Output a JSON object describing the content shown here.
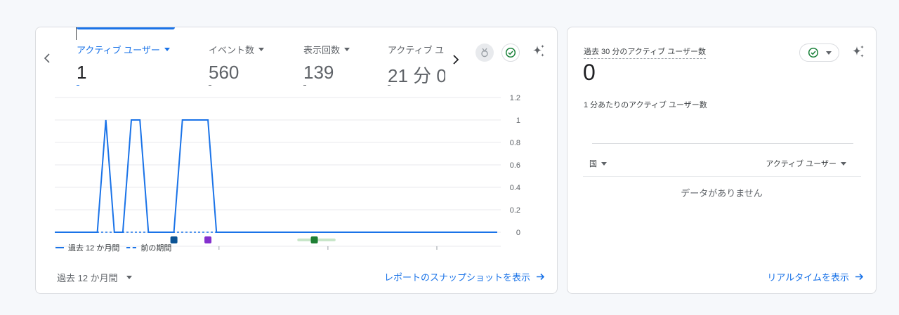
{
  "overview": {
    "metrics": [
      {
        "label": "アクティブ ユーザー",
        "value": "1",
        "active": true
      },
      {
        "label": "イベント数",
        "value": "560",
        "active": false
      },
      {
        "label": "表示回数",
        "value": "139",
        "active": false
      },
      {
        "label": "アクティブ ユ",
        "value": "21 分 0",
        "active": false
      }
    ],
    "legend": {
      "current": "過去 12 か月間",
      "previous": "前の期間"
    },
    "date_range": "過去 12 か月間",
    "snapshot_link": "レポートのスナップショットを表示"
  },
  "chart_data": {
    "type": "line",
    "y_ticks": [
      "1.2",
      "1",
      "0.8",
      "0.6",
      "0.4",
      "0.2",
      "0"
    ],
    "ylim": [
      0,
      1.2
    ],
    "x_ticks": [
      {
        "day": "01",
        "month": "7月"
      },
      {
        "day": "01",
        "month": "10月"
      },
      {
        "day": "01",
        "month": "1月"
      },
      {
        "day": "01",
        "month": "4月"
      }
    ],
    "series": [
      {
        "name": "過去 12 か月間",
        "style": "solid",
        "color": "#1a73e8",
        "values": [
          0,
          0,
          0,
          0,
          0,
          0,
          1,
          0,
          0,
          1,
          1,
          0,
          0,
          0,
          0,
          1,
          1,
          1,
          1,
          0,
          0,
          0,
          0,
          0,
          0,
          0,
          0,
          0,
          0,
          0,
          0,
          0,
          0,
          0,
          0,
          0,
          0,
          0,
          0,
          0,
          0,
          0,
          0,
          0,
          0,
          0,
          0,
          0,
          0,
          0,
          0,
          0,
          0
        ]
      },
      {
        "name": "前の期間",
        "style": "dashed",
        "color": "#1a73e8",
        "values": [
          0,
          0,
          0,
          0,
          0,
          0,
          0,
          0,
          0,
          0,
          0,
          0,
          0,
          0,
          0,
          0,
          0,
          0,
          0,
          0
        ]
      }
    ],
    "annotations": [
      {
        "color": "#0b5394",
        "week": 14
      },
      {
        "color": "#8430ce",
        "week": 18
      },
      {
        "color": "#1e7f34",
        "week": 30.5,
        "range_weeks": [
          28.5,
          33
        ]
      }
    ],
    "grid": true
  },
  "realtime": {
    "title": "過去 30 分のアクティブ ユーザー数",
    "value": "0",
    "subtitle": "1 分あたりのアクティブ ユーザー数",
    "col_country": "国",
    "col_users": "アクティブ ユーザー",
    "empty": "データがありません",
    "link": "リアルタイムを表示"
  },
  "colors": {
    "accent": "#1a73e8",
    "check": "#188038",
    "border": "#dadce0"
  },
  "icons": [
    "chevron-left-icon",
    "chevron-right-icon",
    "insights-badge-icon",
    "check-circle-icon",
    "sparkle-icon",
    "arrow-right-icon"
  ]
}
